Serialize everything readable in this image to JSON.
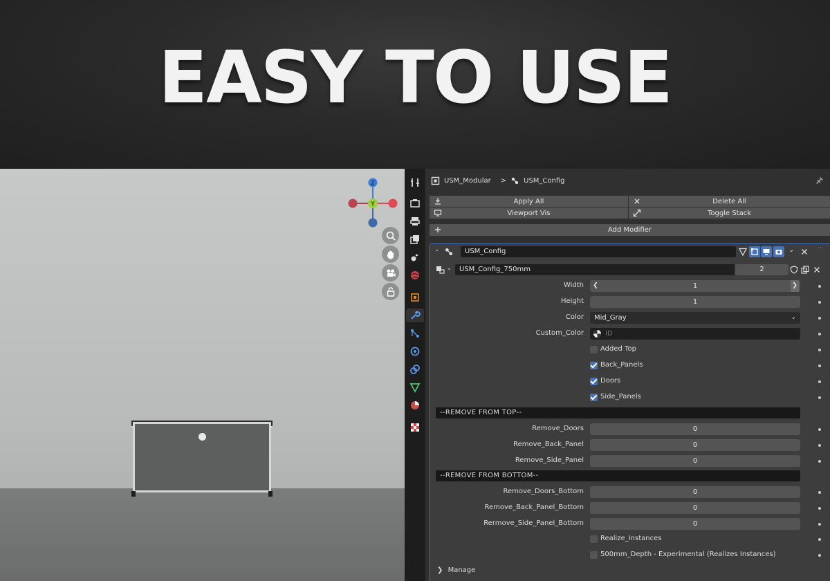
{
  "hero": {
    "title": "EASY TO USE"
  },
  "viewport": {
    "gizmo": {
      "z": "Z",
      "y": "Y"
    }
  },
  "breadcrumb": {
    "object": "USM_Modular",
    "separator": ">",
    "modifier": "USM_Config"
  },
  "toolbar": {
    "apply_all": "Apply All",
    "delete_all": "Delete All",
    "viewport_vis": "Viewport Vis",
    "toggle_stack": "Toggle Stack",
    "add_modifier": "Add Modifier"
  },
  "modifier": {
    "name": "USM_Config",
    "node_group": "USM_Config_750mm",
    "users": "2",
    "fields": {
      "width": {
        "label": "Width",
        "value": "1"
      },
      "height": {
        "label": "Height",
        "value": "1"
      },
      "color": {
        "label": "Color",
        "value": "Mid_Gray"
      },
      "custom_color": {
        "label": "Custom_Color",
        "placeholder": "ID"
      }
    },
    "checks": {
      "added_top": {
        "label": "Added Top",
        "checked": false
      },
      "back_panels": {
        "label": "Back_Panels",
        "checked": true
      },
      "doors": {
        "label": "Doors",
        "checked": true
      },
      "side_panels": {
        "label": "Side_Panels",
        "checked": true
      }
    },
    "remove_top": {
      "header": "--REMOVE FROM TOP--",
      "doors": {
        "label": "Remove_Doors",
        "value": "0"
      },
      "back_panel": {
        "label": "Remove_Back_Panel",
        "value": "0"
      },
      "side_panel": {
        "label": "Remove_Side_Panel",
        "value": "0"
      }
    },
    "remove_bottom": {
      "header": "--REMOVE FROM BOTTOM--",
      "doors": {
        "label": "Remove_Doors_Bottom",
        "value": "0"
      },
      "back_panel": {
        "label": "Remove_Back_Panel_Bottom",
        "value": "0"
      },
      "side_panel": {
        "label": "Rermove_Side_Panel_Bottom",
        "value": "0"
      }
    },
    "realize_instances": {
      "label": "Realize_Instances",
      "checked": false
    },
    "depth_500": {
      "label": "500mm_Depth - Experimental (Realizes Instances)",
      "checked": false
    },
    "manage": "Manage"
  },
  "colors": {
    "accent": "#4772b3",
    "x_axis": "#e04a55",
    "y_axis": "#8bc43f",
    "z_axis": "#3d7fd8"
  }
}
